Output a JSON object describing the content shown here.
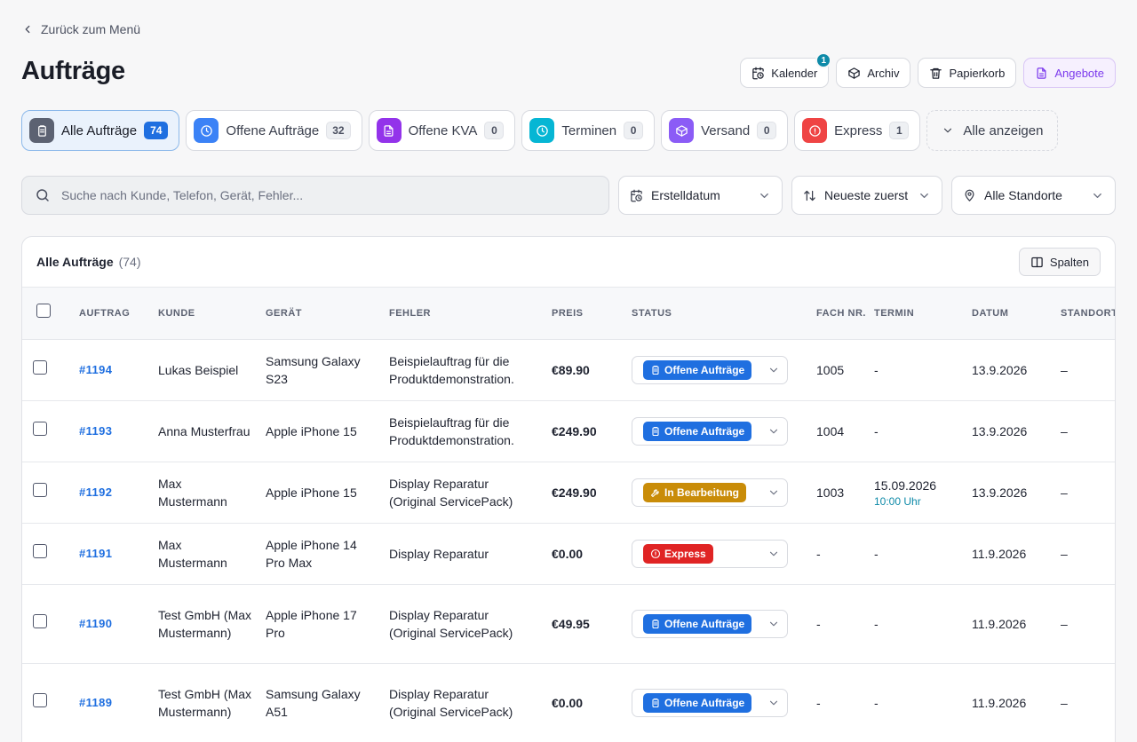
{
  "nav": {
    "back_label": "Zurück zum Menü"
  },
  "header": {
    "title": "Aufträge",
    "actions": [
      {
        "label": "Kalender",
        "icon": "calendar-clock-icon",
        "badge": "1"
      },
      {
        "label": "Archiv",
        "icon": "box-icon"
      },
      {
        "label": "Papierkorb",
        "icon": "trash-icon"
      },
      {
        "label": "Angebote",
        "icon": "document-icon"
      }
    ]
  },
  "tabs": [
    {
      "label": "Alle Aufträge",
      "count": "74",
      "icon": "clipboard-icon",
      "color": "#5c6272",
      "active": true
    },
    {
      "label": "Offene Aufträge",
      "count": "32",
      "icon": "clock-icon",
      "color": "#3b82f6"
    },
    {
      "label": "Offene KVA",
      "count": "0",
      "icon": "document-icon",
      "color": "#9333ea"
    },
    {
      "label": "Terminen",
      "count": "0",
      "icon": "clock-icon",
      "color": "#06b6d4"
    },
    {
      "label": "Versand",
      "count": "0",
      "icon": "package-icon",
      "color": "#8b5cf6"
    },
    {
      "label": "Express",
      "count": "1",
      "icon": "alert-circle-icon",
      "color": "#ef4444"
    }
  ],
  "show_all_label": "Alle anzeigen",
  "filters": {
    "search_placeholder": "Suche nach Kunde, Telefon, Gerät, Fehler...",
    "date_filter": "Erstelldatum",
    "sort": "Neueste zuerst",
    "location": "Alle Standorte"
  },
  "table": {
    "title": "Alle Aufträge",
    "count": "(74)",
    "columns_button": "Spalten",
    "headers": {
      "auftrag": "AUFTRAG",
      "kunde": "KUNDE",
      "geraet": "GERÄT",
      "fehler": "FEHLER",
      "preis": "PREIS",
      "status": "STATUS",
      "fach": "FACH NR.",
      "termin": "TERMIN",
      "datum": "DATUM",
      "standort": "STANDORT"
    },
    "rows": [
      {
        "id": "#1194",
        "kunde": "Lukas Beispiel",
        "geraet": "Samsung Galaxy S23",
        "fehler": "Beispielauftrag für die Produktdemonstration.",
        "preis": "€89.90",
        "status": "Offene Aufträge",
        "status_color": "blue",
        "fach": "1005",
        "termin": "-",
        "termin_time": "",
        "datum": "13.9.2026",
        "standort": "–"
      },
      {
        "id": "#1193",
        "kunde": "Anna Musterfrau",
        "geraet": "Apple iPhone 15",
        "fehler": "Beispielauftrag für die Produktdemonstration.",
        "preis": "€249.90",
        "status": "Offene Aufträge",
        "status_color": "blue",
        "fach": "1004",
        "termin": "-",
        "termin_time": "",
        "datum": "13.9.2026",
        "standort": "–"
      },
      {
        "id": "#1192",
        "kunde": "Max Mustermann",
        "geraet": "Apple iPhone 15",
        "fehler": "Display Reparatur (Original ServicePack)",
        "preis": "€249.90",
        "status": "In Bearbeitung",
        "status_color": "amber",
        "fach": "1003",
        "termin": "15.09.2026",
        "termin_time": "10:00 Uhr",
        "datum": "13.9.2026",
        "standort": "–"
      },
      {
        "id": "#1191",
        "kunde": "Max Mustermann",
        "geraet": "Apple iPhone 14 Pro Max",
        "fehler": "Display Reparatur",
        "preis": "€0.00",
        "status": "Express",
        "status_color": "red",
        "fach": "-",
        "termin": "-",
        "termin_time": "",
        "datum": "11.9.2026",
        "standort": "–"
      },
      {
        "id": "#1190",
        "kunde": "Test GmbH (Max Mustermann)",
        "geraet": "Apple iPhone 17 Pro",
        "fehler": "Display Reparatur (Original ServicePack)",
        "preis": "€49.95",
        "status": "Offene Aufträge",
        "status_color": "blue",
        "fach": "-",
        "termin": "-",
        "termin_time": "",
        "datum": "11.9.2026",
        "standort": "–"
      },
      {
        "id": "#1189",
        "kunde": "Test GmbH (Max Mustermann)",
        "geraet": "Samsung Galaxy A51",
        "fehler": "Display Reparatur (Original ServicePack)",
        "preis": "€0.00",
        "status": "Offene Aufträge",
        "status_color": "blue",
        "fach": "-",
        "termin": "-",
        "termin_time": "",
        "datum": "11.9.2026",
        "standort": "–"
      }
    ]
  }
}
